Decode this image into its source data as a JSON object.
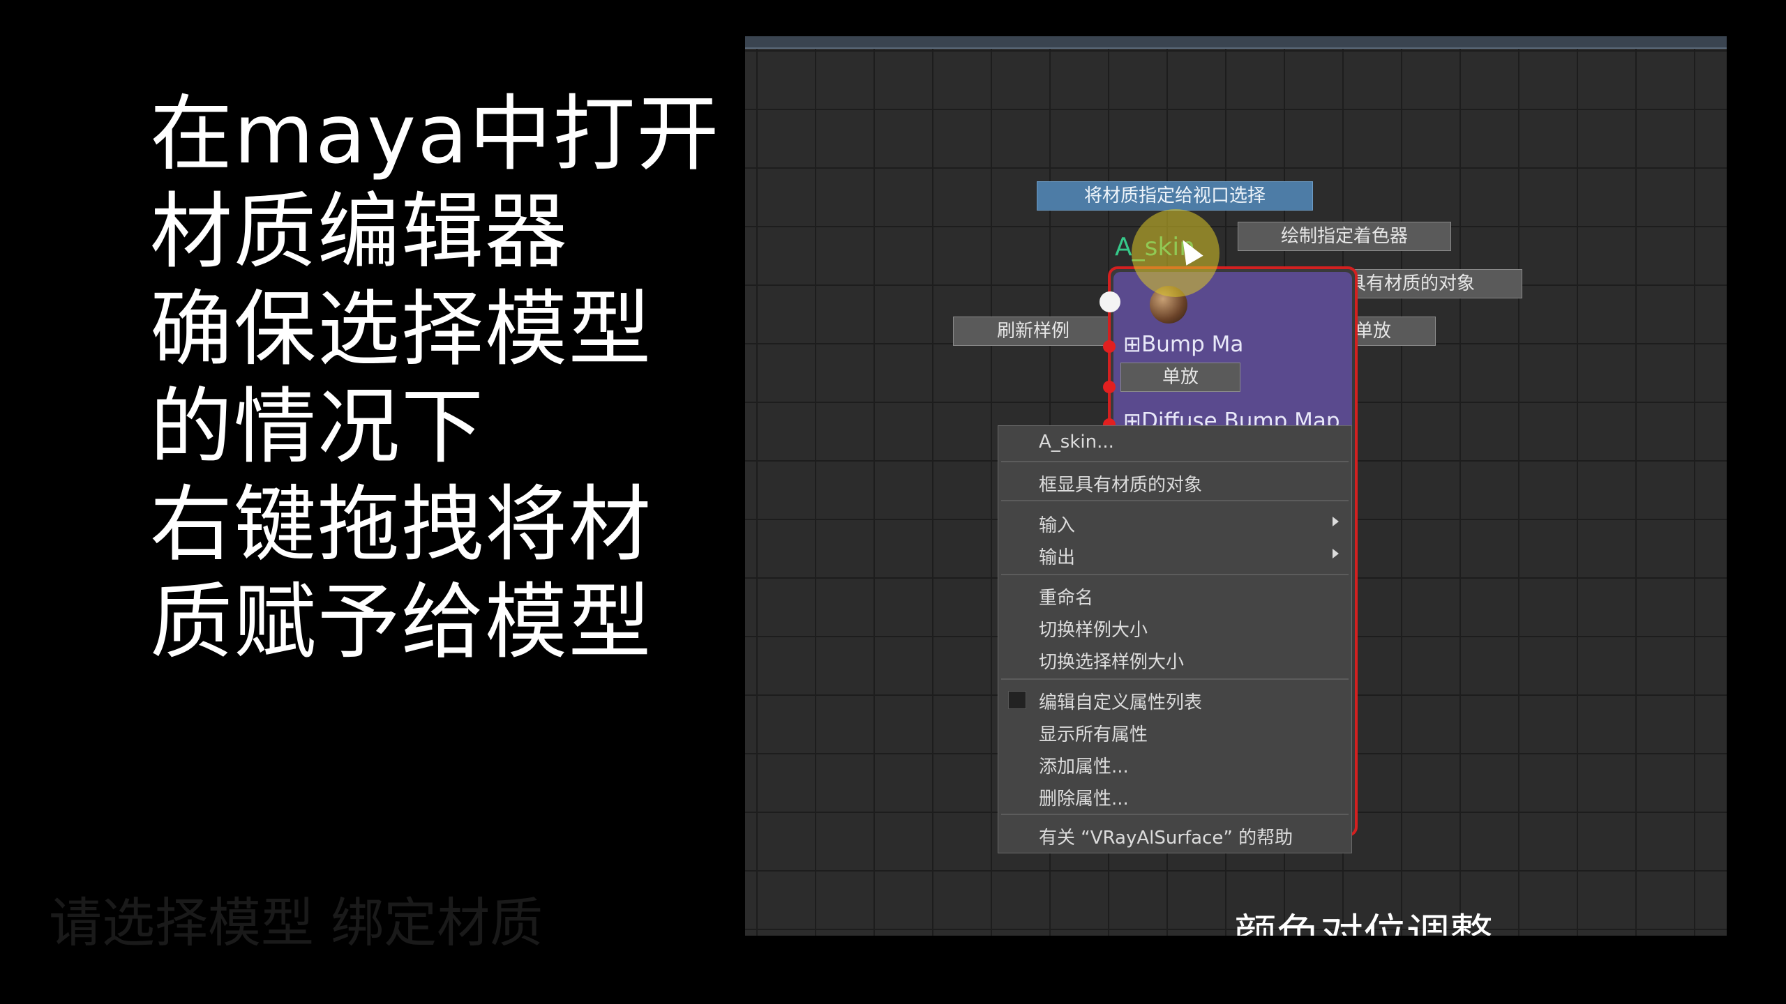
{
  "caption": {
    "lines": [
      "在maya中打开",
      "材质编辑器",
      "确保选择模型",
      "的情况下",
      "右键拖拽将材",
      "质赋予给模型"
    ],
    "faded": "请选择模型 绑定材质"
  },
  "hypershade": {
    "buttons": {
      "assign": "将材质指定给视口选择",
      "paint": "绘制指定着色器",
      "select_objects": "选择具有材质的对象",
      "refresh": "刷新样例",
      "remove_single": "移除材质单放",
      "single": "单放"
    },
    "node": {
      "title": "A_skin",
      "attr1": "⊞Bump Ma",
      "attr2": "⊞Diffuse Bump Map"
    },
    "menu": {
      "items": [
        "A_skin...",
        "框显具有材质的对象",
        "输入",
        "输出",
        "重命名",
        "切换样例大小",
        "切换选择样例大小",
        "编辑自定义属性列表",
        "显示所有属性",
        "添加属性...",
        "删除属性...",
        "有关 “VRayAlSurface” 的帮助"
      ]
    },
    "bottom_caption": "颜色对位调整"
  }
}
